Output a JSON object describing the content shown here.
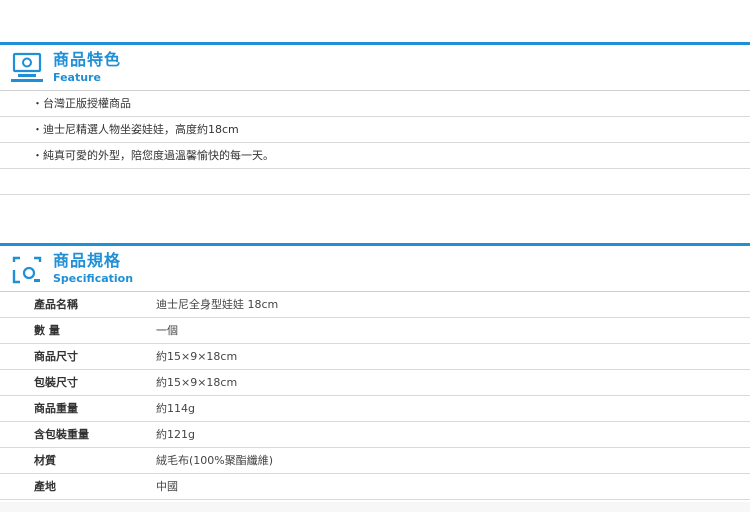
{
  "feature": {
    "title_zh": "商品特色",
    "title_en": "Feature",
    "items": [
      "・台灣正版授權商品",
      "・迪士尼精選人物坐姿娃娃，高度約18cm",
      "・純真可愛的外型，陪您度過溫馨愉快的每一天。"
    ]
  },
  "spec": {
    "title_zh": "商品規格",
    "title_en": "Specification",
    "rows": [
      {
        "key": "產品名稱",
        "value": "迪士尼全身型娃娃 18cm"
      },
      {
        "key": "數 量",
        "value": "一個"
      },
      {
        "key": "商品尺寸",
        "value": "約15×9×18cm"
      },
      {
        "key": "包裝尺寸",
        "value": "約15×9×18cm"
      },
      {
        "key": "商品重量",
        "value": "約114g"
      },
      {
        "key": "含包裝重量",
        "value": "約121g"
      },
      {
        "key": "材質",
        "value": "絨毛布(100%聚酯纖維)"
      },
      {
        "key": "產地",
        "value": "中國"
      }
    ]
  },
  "colors": {
    "accent": "#1f8fd6",
    "divider": "#d9d9d9"
  },
  "icons": {
    "feature": "monitor-icon",
    "spec": "camera-icon"
  }
}
